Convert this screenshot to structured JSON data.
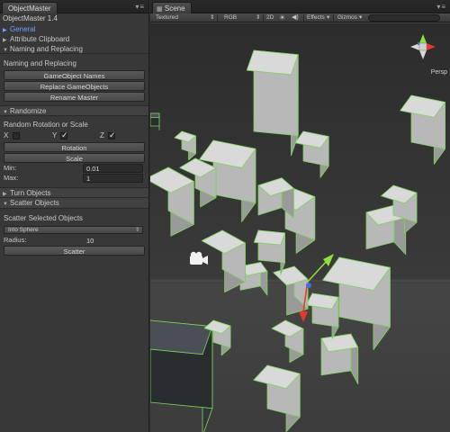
{
  "left_panel": {
    "tab_title": "ObjectMaster",
    "tab_menu": "▾≡",
    "app_title": "ObjectMaster 1.4",
    "folds": [
      {
        "label": "General",
        "expanded": true,
        "active": true
      },
      {
        "label": "Attribute Clipboard",
        "expanded": false,
        "active": false
      },
      {
        "label": "Naming and Replacing",
        "expanded": true,
        "active": false
      }
    ],
    "naming": {
      "header": "Naming and Replacing",
      "buttons": [
        "GameObject Names",
        "Replace GameObjects",
        "Rename Master"
      ]
    },
    "randomize": {
      "fold_label": "Randomize",
      "header": "Random Rotation or Scale",
      "axis_x": "X",
      "axis_y": "Y",
      "axis_z": "Z",
      "x_checked": false,
      "y_checked": true,
      "z_checked": true,
      "rotation_button": "Rotation",
      "scale_button": "Scale",
      "min_label": "Min:",
      "min_value": "0.01",
      "max_label": "Max:",
      "max_value": "1"
    },
    "turn_objects": {
      "label": "Turn Objects"
    },
    "scatter": {
      "fold_label": "Scatter Objects",
      "header": "Scatter Selected Objects",
      "mode_value": "Into Sphere",
      "radius_label": "Radius:",
      "radius_value": "10",
      "scatter_button": "Scatter"
    }
  },
  "scene": {
    "tab_title": "Scene",
    "tab_menu": "▾≡",
    "toolbar": {
      "render_mode": "Textured",
      "color_mode": "RGB",
      "mode_2d": "2D",
      "light_icon": "sun-icon",
      "audio_icon": "speaker-icon",
      "effects": "Effects",
      "gizmos": "Gizmos"
    },
    "gizmo": {
      "projection_label": "Persp"
    },
    "colors": {
      "cube_face": "#d9d9d9",
      "cube_shade": "#9a9a9a",
      "cube_dark": "#4a4f55",
      "selection_edge": "#7cd35a",
      "background_top": "#2e2e2e",
      "background_bottom": "#3e3e3e",
      "axis_x": "#e23b2a",
      "axis_y": "#8fe03c",
      "axis_z": "#3a6ff0"
    }
  }
}
